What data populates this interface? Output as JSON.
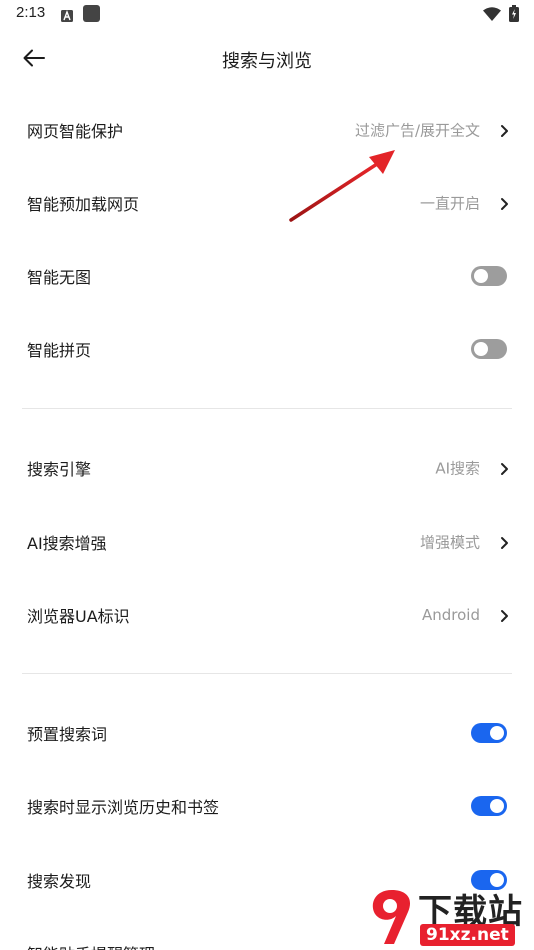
{
  "status_bar": {
    "time": "2:13",
    "icons": [
      "keyboard-a-icon",
      "notification-square-icon",
      "wifi-icon",
      "battery-icon"
    ]
  },
  "header": {
    "title": "搜索与浏览",
    "back_icon": "back-arrow-icon"
  },
  "settings": {
    "web_protection": {
      "label": "网页智能保护",
      "value": "过滤广告/展开全文"
    },
    "preload": {
      "label": "智能预加载网页",
      "value": "一直开启"
    },
    "no_image": {
      "label": "智能无图",
      "on": false
    },
    "page_join": {
      "label": "智能拼页",
      "on": false
    },
    "search_engine": {
      "label": "搜索引擎",
      "value": "AI搜索"
    },
    "ai_enhance": {
      "label": "AI搜索增强",
      "value": "增强模式"
    },
    "ua": {
      "label": "浏览器UA标识",
      "value": "Android"
    },
    "preset_words": {
      "label": "预置搜索词",
      "on": true
    },
    "show_history": {
      "label": "搜索时显示浏览历史和书签",
      "on": true
    },
    "discover": {
      "label": "搜索发现",
      "on": true
    },
    "clipboard": {
      "label": "智能贴手提醒管理"
    }
  },
  "watermark": {
    "text": "下载站",
    "url": "91xz.net"
  },
  "colors": {
    "accent": "#1a66ef",
    "toggle_off": "#9d9d9d",
    "arrow": "#d9201f",
    "secondary_text": "#9a9a9a"
  }
}
